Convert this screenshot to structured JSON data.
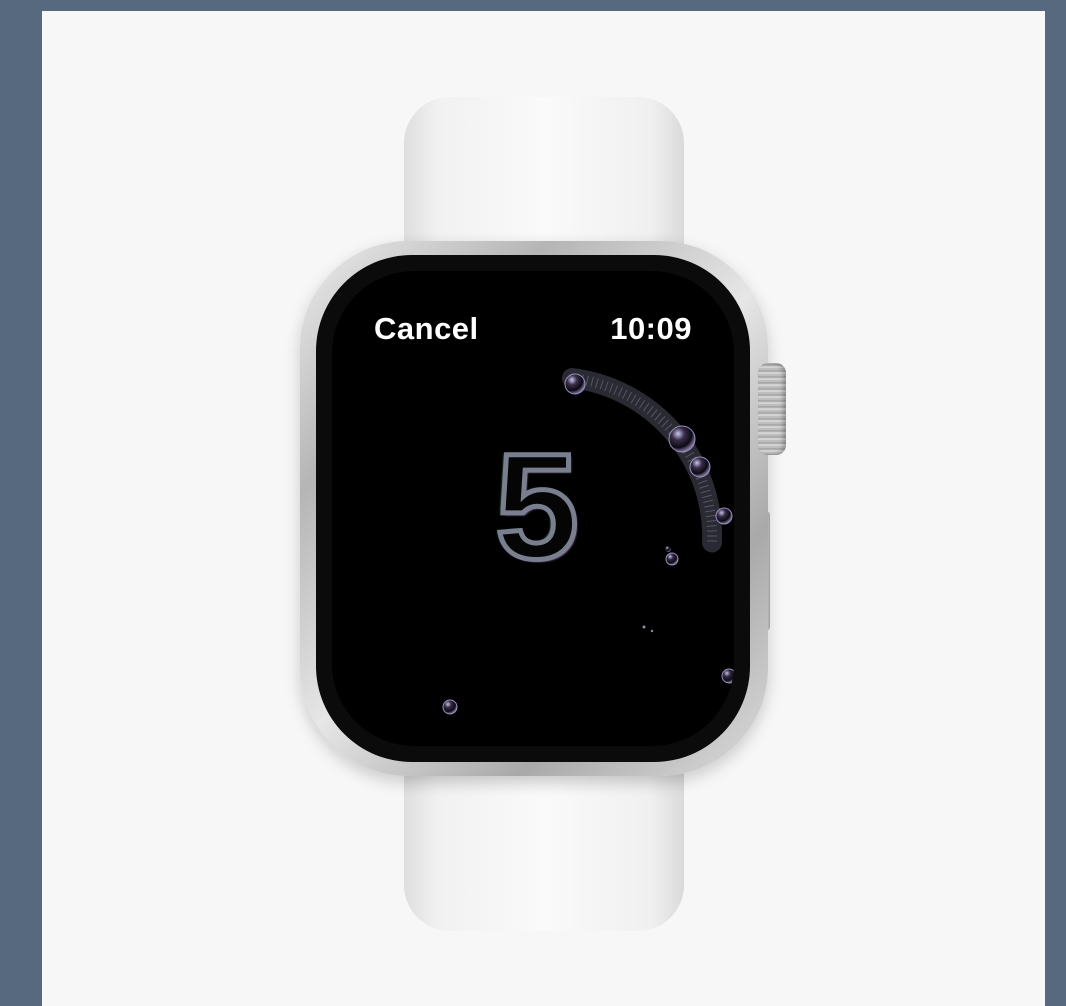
{
  "watch": {
    "cancel_label": "Cancel",
    "time": "10:09",
    "countdown": "5"
  },
  "colors": {
    "background": "#56697f",
    "frame": "#f7f7f7",
    "screen": "#000000",
    "text": "#ffffff"
  }
}
